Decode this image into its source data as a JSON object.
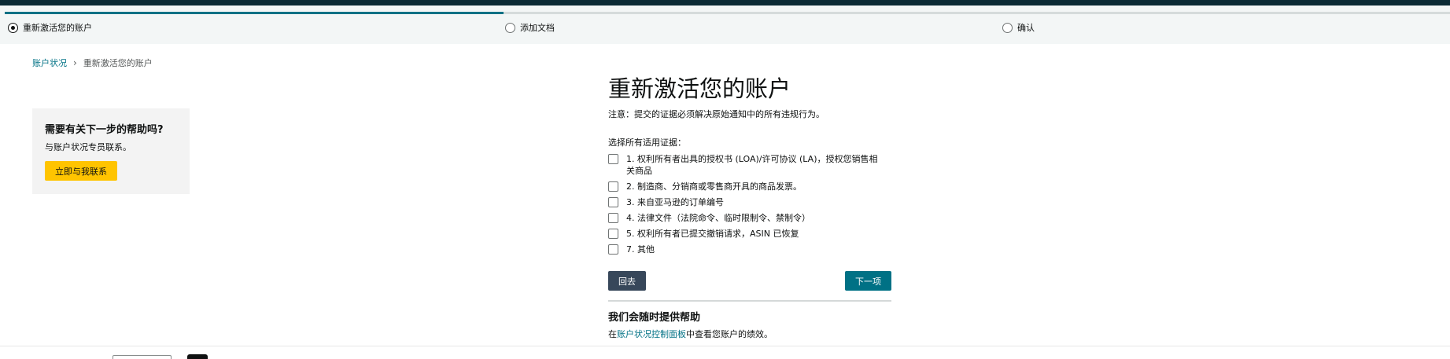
{
  "stepper": {
    "progress_fraction": 0.345,
    "steps": [
      {
        "label": "重新激活您的账户",
        "selected": true
      },
      {
        "label": "添加文档",
        "selected": false
      },
      {
        "label": "确认",
        "selected": false
      }
    ]
  },
  "breadcrumb": {
    "parent": "账户状况",
    "separator": "›",
    "current": "重新激活您的账户"
  },
  "help_card": {
    "title": "需要有关下一步的帮助吗?",
    "text": "与账户状况专员联系。",
    "button": "立即与我联系"
  },
  "main": {
    "title": "重新激活您的账户",
    "notice": "注意：提交的证据必须解决原始通知中的所有违规行为。",
    "select_label": "选择所有适用证据：",
    "options": [
      "1. 权利所有者出具的授权书 (LOA)/许可协议 (LA)，授权您销售相关商品",
      "2. 制造商、分销商或零售商开具的商品发票。",
      "3. 来自亚马逊的订单编号",
      "4. 法律文件（法院命令、临时限制令、禁制令）",
      "5. 权利所有者已提交撤销请求，ASIN 已恢复",
      "7. 其他"
    ],
    "back_button": "回去",
    "next_button": "下一项",
    "assist_title": "我们会随时提供帮助",
    "assist_prefix": "在",
    "assist_link": "账户状况控制面板",
    "assist_suffix": "中查看您账户的绩效。"
  },
  "colors": {
    "accent": "#007185",
    "primary_button": "#ffc400",
    "back_button": "#37475a"
  }
}
